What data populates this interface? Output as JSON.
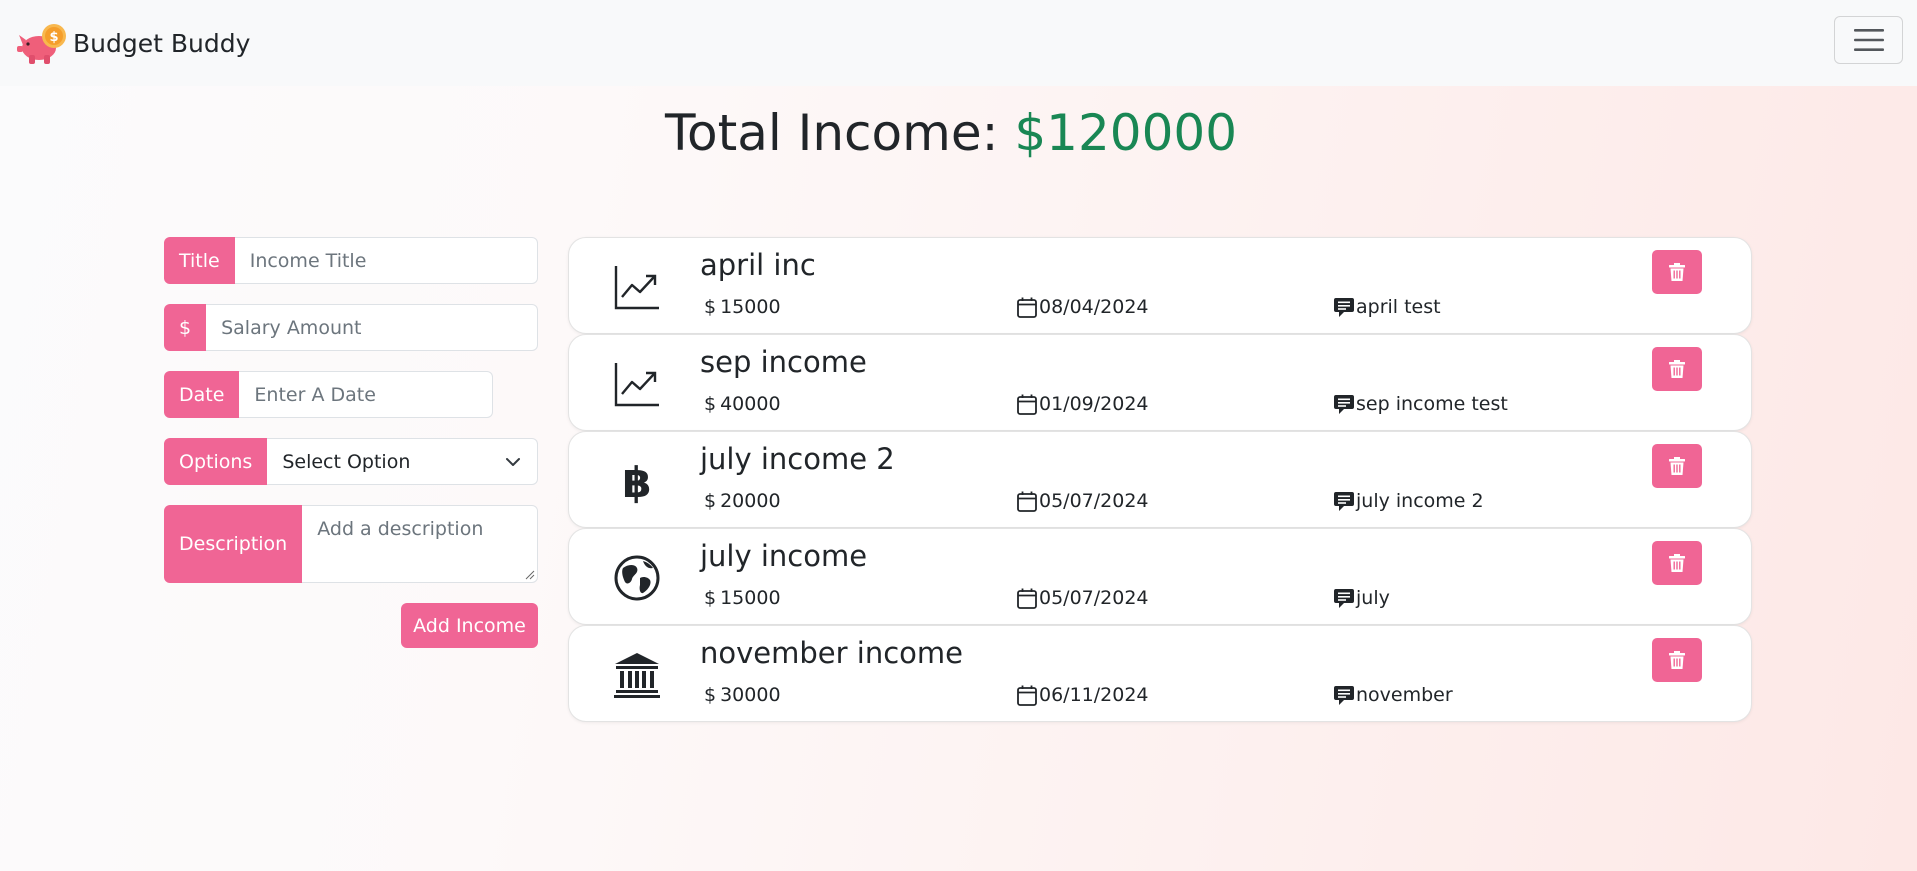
{
  "navbar": {
    "brand_logo_icon": "piggy-bank-coin-icon",
    "brand_name": "Budget Buddy",
    "toggler_icon": "hamburger-menu-icon"
  },
  "heading": {
    "label": "Total Income:",
    "amount": "$120000",
    "amount_color": "#198754"
  },
  "form": {
    "title": {
      "label": "Title",
      "placeholder": "Income Title"
    },
    "amount": {
      "label": "$",
      "placeholder": "Salary Amount"
    },
    "date": {
      "label": "Date",
      "placeholder": "Enter A Date"
    },
    "options": {
      "label": "Options",
      "selected": "Select Option"
    },
    "description": {
      "label": "Description",
      "placeholder": "Add a description"
    },
    "submit_label": "Add Income",
    "accent_color": "#f06595"
  },
  "incomes": [
    {
      "icon": "chart-line-up-icon",
      "title": "april inc",
      "currency": "$",
      "amount": "15000",
      "date": "08/04/2024",
      "note": "april test"
    },
    {
      "icon": "chart-line-up-icon",
      "title": "sep income",
      "currency": "$",
      "amount": "40000",
      "date": "01/09/2024",
      "note": "sep income test"
    },
    {
      "icon": "bitcoin-icon",
      "title": "july income 2",
      "currency": "$",
      "amount": "20000",
      "date": "05/07/2024",
      "note": "july income 2"
    },
    {
      "icon": "globe-icon",
      "title": "july income",
      "currency": "$",
      "amount": "15000",
      "date": "05/07/2024",
      "note": "july"
    },
    {
      "icon": "bank-icon",
      "title": "november income",
      "currency": "$",
      "amount": "30000",
      "date": "06/11/2024",
      "note": "november"
    }
  ]
}
